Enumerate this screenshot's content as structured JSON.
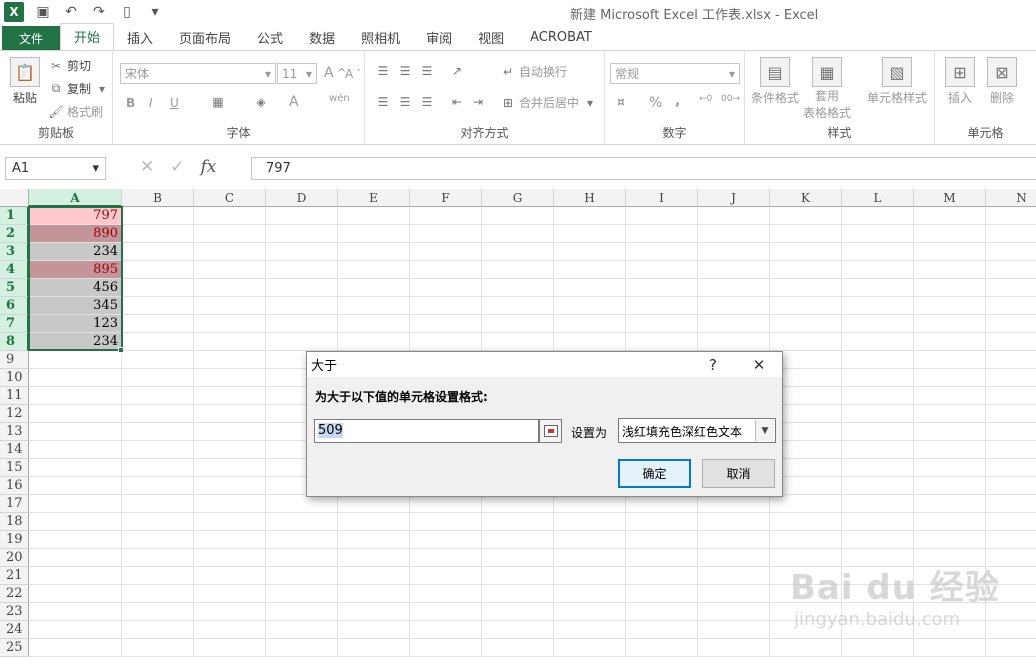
{
  "window_title": "新建 Microsoft Excel 工作表.xlsx - Excel",
  "colors": {
    "excel_green": "#217346",
    "light_red_fill": "#ffc7ce",
    "dark_red_fill": "#c4949b",
    "gray_fill": "#c8c8c8",
    "dark_red_text": "#9c0006"
  },
  "tabs": {
    "file": "文件",
    "home": "开始",
    "insert": "插入",
    "layout": "页面布局",
    "formulas": "公式",
    "data": "数据",
    "camera": "照相机",
    "review": "审阅",
    "view": "视图",
    "acrobat": "ACROBAT"
  },
  "ribbon": {
    "clipboard": {
      "paste": "粘贴",
      "cut": "剪切",
      "copy": "复制",
      "format_painter": "格式刷",
      "label": "剪贴板"
    },
    "font": {
      "font_name": "宋体",
      "font_size": "11",
      "bold": "B",
      "italic": "I",
      "underline": "U",
      "label": "字体"
    },
    "alignment": {
      "wrap": "自动换行",
      "merge": "合并后居中",
      "label": "对齐方式"
    },
    "number": {
      "format": "常规",
      "percent": "%",
      "comma": ",",
      "label": "数字"
    },
    "styles": {
      "conditional": "条件格式",
      "table1": "套用",
      "table2": "表格格式",
      "cell_styles": "单元格样式",
      "label": "样式"
    },
    "cells": {
      "insert": "插入",
      "delete": "删除",
      "label": "单元格"
    }
  },
  "formula_bar": {
    "name_box": "A1",
    "formula": "797",
    "cancel": "✕",
    "enter": "✓",
    "fx": "fx"
  },
  "columns": [
    "A",
    "B",
    "C",
    "D",
    "E",
    "F",
    "G",
    "H",
    "I",
    "J",
    "K",
    "L",
    "M",
    "N"
  ],
  "rows": [
    "1",
    "2",
    "3",
    "4",
    "5",
    "6",
    "7",
    "8",
    "9",
    "10",
    "11",
    "12",
    "13",
    "14",
    "15",
    "16",
    "17",
    "18",
    "19",
    "20",
    "21",
    "22",
    "23",
    "24",
    "25"
  ],
  "cells_A": [
    {
      "value": "797",
      "fill": "light"
    },
    {
      "value": "890",
      "fill": "dark"
    },
    {
      "value": "234",
      "fill": "gray"
    },
    {
      "value": "895",
      "fill": "dark"
    },
    {
      "value": "456",
      "fill": "gray"
    },
    {
      "value": "345",
      "fill": "gray"
    },
    {
      "value": "123",
      "fill": "gray"
    },
    {
      "value": "234",
      "fill": "gray"
    }
  ],
  "dialog": {
    "title": "大于",
    "help": "?",
    "close": "✕",
    "prompt": "为大于以下值的单元格设置格式:",
    "input_value": "509",
    "set_as_label": "设置为",
    "format_option": "浅红填充色深红色文本",
    "ok": "确定",
    "cancel": "取消"
  },
  "watermark": {
    "main": "Bai du 经验",
    "sub": "jingyan.baidu.com"
  }
}
